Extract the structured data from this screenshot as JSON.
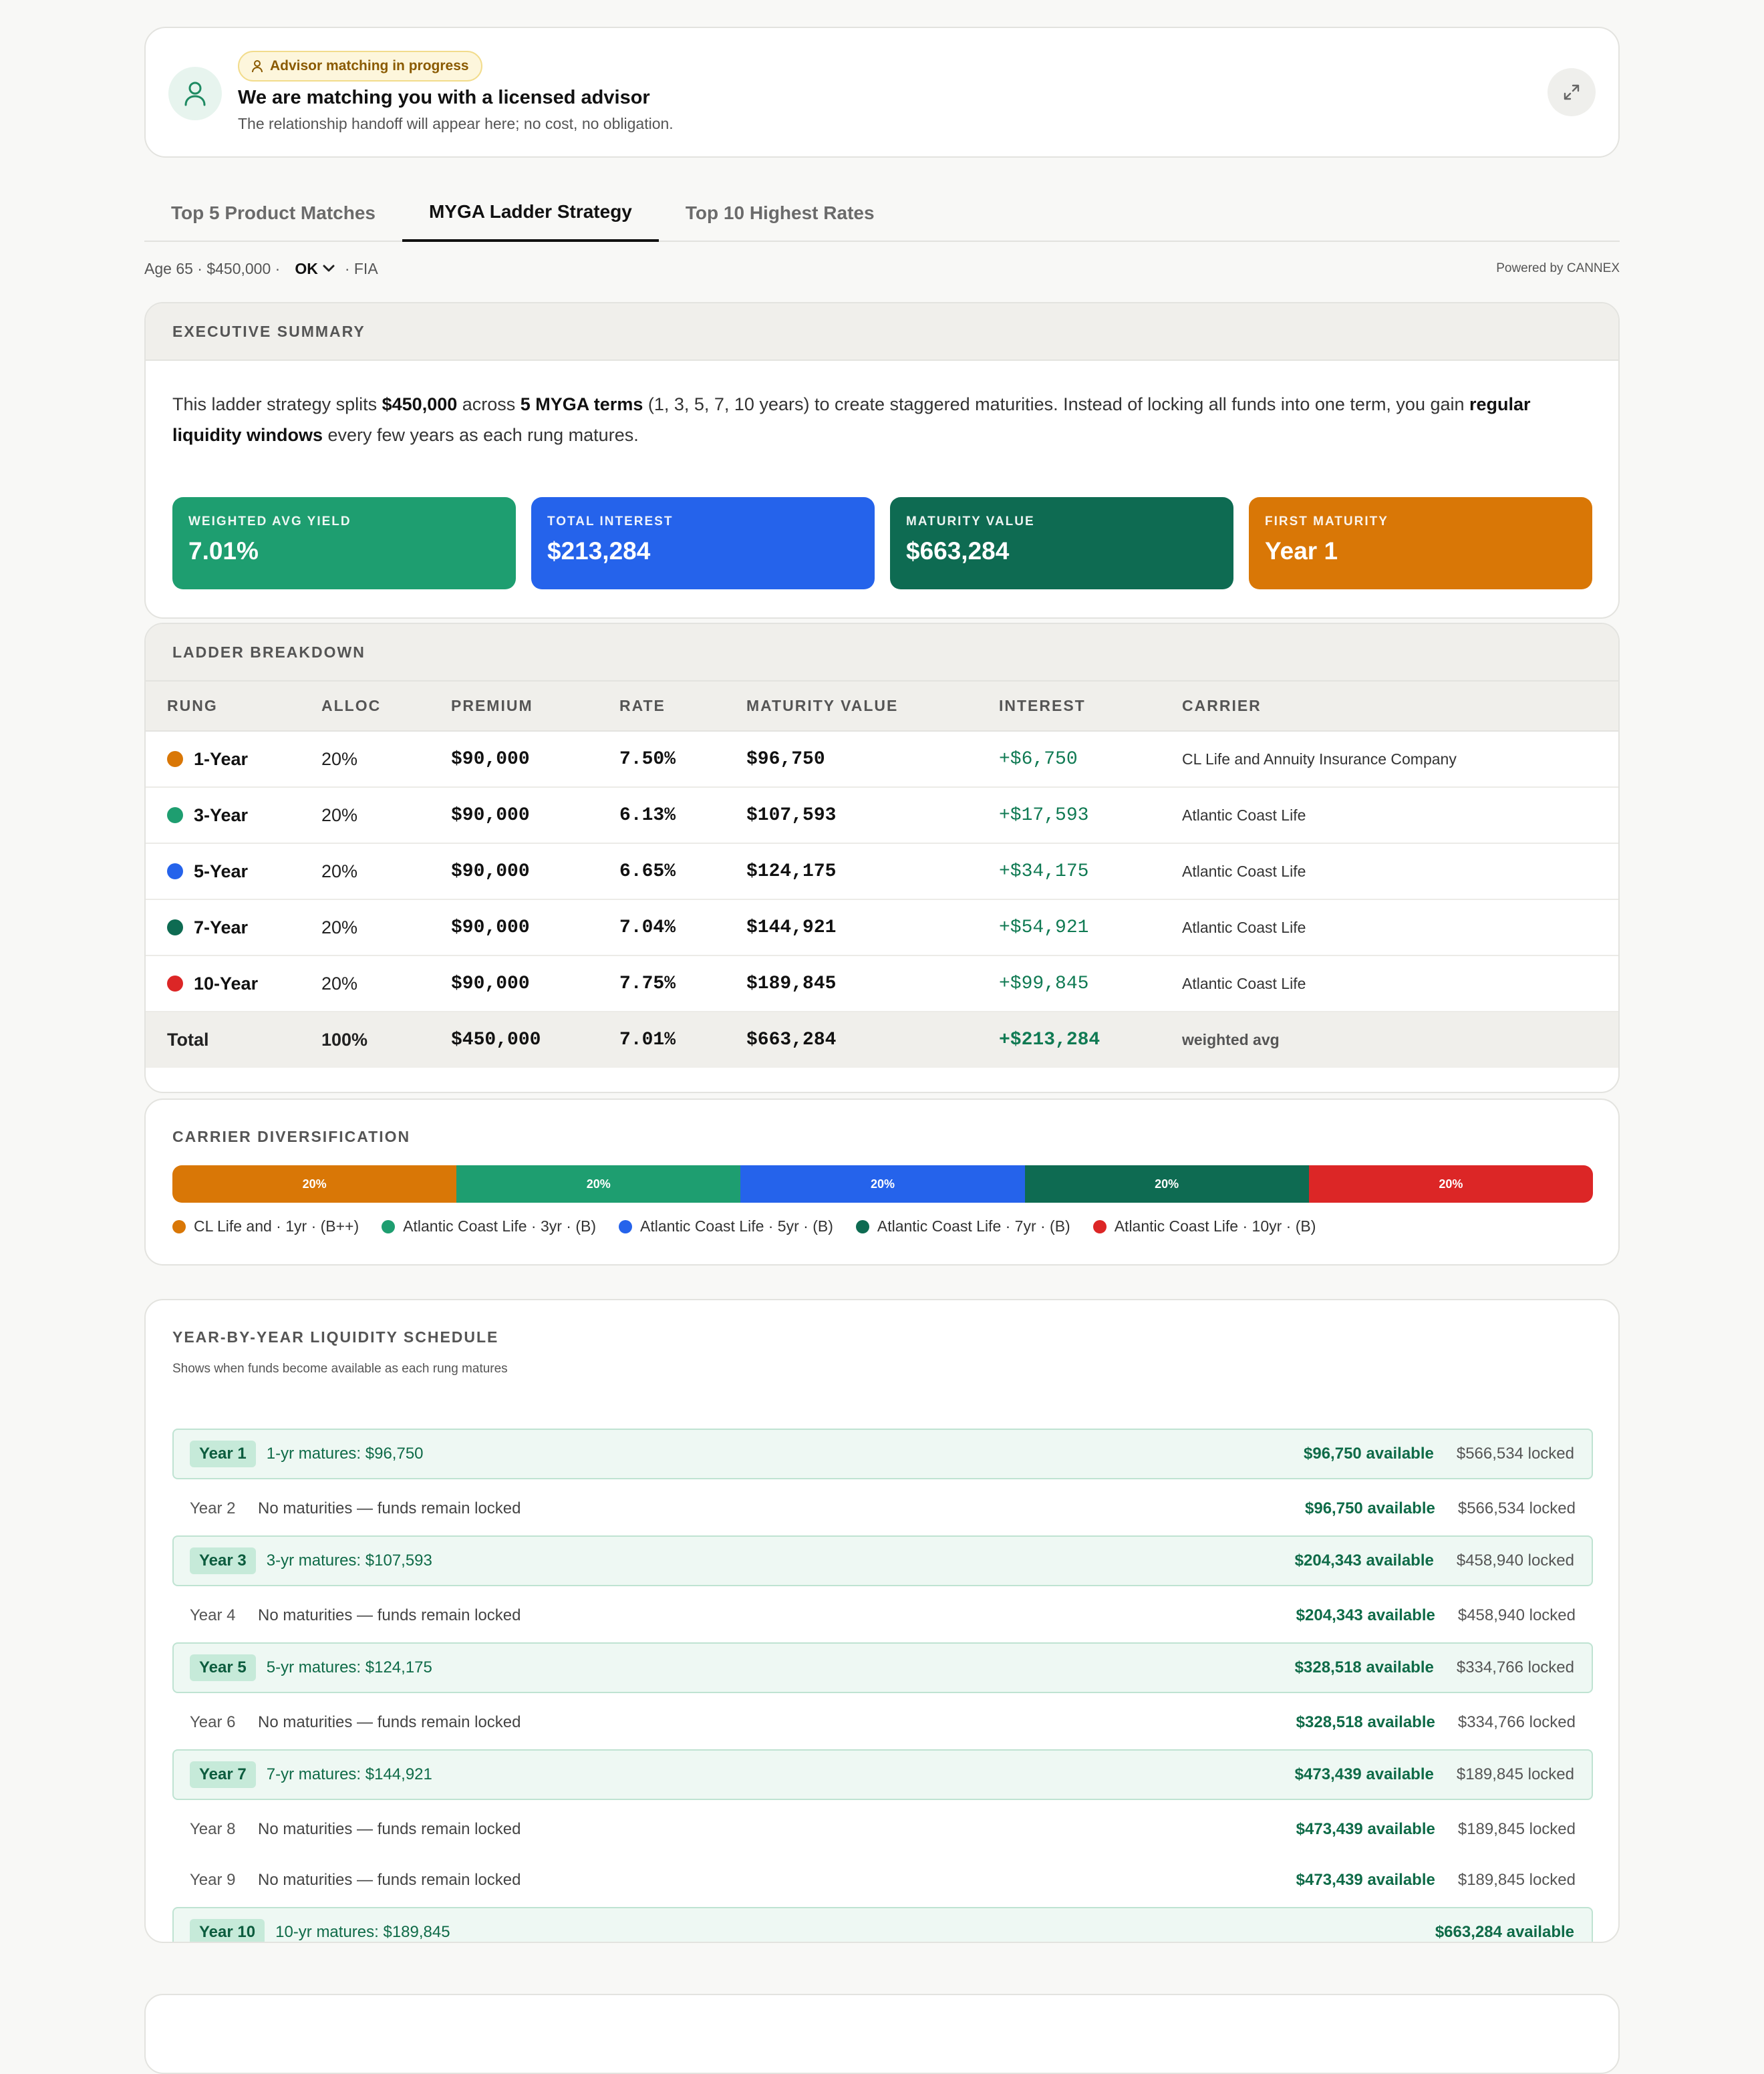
{
  "advisor": {
    "badge": "Advisor matching in progress",
    "title": "We are matching you with a licensed advisor",
    "subtitle": "The relationship handoff will appear here; no cost, no obligation."
  },
  "tabs": [
    "Top 5 Product Matches",
    "MYGA Ladder Strategy",
    "Top 10 Highest Rates"
  ],
  "active_tab": "MYGA Ladder Strategy",
  "filters": {
    "prefix": "Age 65 · $450,000 ·",
    "state": "OK",
    "suffix": "· FIA",
    "powered_by": "Powered by CANNEX"
  },
  "executive_summary": {
    "heading": "EXECUTIVE SUMMARY",
    "text_1": "This ladder strategy splits ",
    "bold_1": "$450,000",
    "text_2": " across ",
    "bold_2": "5 MYGA terms",
    "text_3": " (1, 3, 5, 7, 10 years) to create staggered maturities. Instead of locking all funds into one term, you gain ",
    "bold_3": "regular liquidity windows",
    "text_4": " every few years as each rung matures.",
    "tiles": [
      {
        "label": "WEIGHTED AVG YIELD",
        "value": "7.01%",
        "color": "#1e9e70"
      },
      {
        "label": "TOTAL INTEREST",
        "value": "$213,284",
        "color": "#2563eb"
      },
      {
        "label": "MATURITY VALUE",
        "value": "$663,284",
        "color": "#0e6b52"
      },
      {
        "label": "FIRST MATURITY",
        "value": "Year 1",
        "color": "#d97706"
      }
    ]
  },
  "ladder": {
    "heading": "LADDER BREAKDOWN",
    "columns": [
      "RUNG",
      "ALLOC",
      "PREMIUM",
      "RATE",
      "MATURITY VALUE",
      "INTEREST",
      "CARRIER"
    ],
    "rows": [
      {
        "rung": "1-Year",
        "color": "#d97706",
        "alloc": "20%",
        "premium": "$90,000",
        "rate": "7.50%",
        "maturity": "$96,750",
        "interest": "+$6,750",
        "carrier": "CL Life and Annuity Insurance Company"
      },
      {
        "rung": "3-Year",
        "color": "#1e9e70",
        "alloc": "20%",
        "premium": "$90,000",
        "rate": "6.13%",
        "maturity": "$107,593",
        "interest": "+$17,593",
        "carrier": "Atlantic Coast Life"
      },
      {
        "rung": "5-Year",
        "color": "#2563eb",
        "alloc": "20%",
        "premium": "$90,000",
        "rate": "6.65%",
        "maturity": "$124,175",
        "interest": "+$34,175",
        "carrier": "Atlantic Coast Life"
      },
      {
        "rung": "7-Year",
        "color": "#0e6b52",
        "alloc": "20%",
        "premium": "$90,000",
        "rate": "7.04%",
        "maturity": "$144,921",
        "interest": "+$54,921",
        "carrier": "Atlantic Coast Life"
      },
      {
        "rung": "10-Year",
        "color": "#dc2626",
        "alloc": "20%",
        "premium": "$90,000",
        "rate": "7.75%",
        "maturity": "$189,845",
        "interest": "+$99,845",
        "carrier": "Atlantic Coast Life"
      }
    ],
    "total": {
      "rung": "Total",
      "alloc": "100%",
      "premium": "$450,000",
      "rate": "7.01%",
      "maturity": "$663,284",
      "interest": "+$213,284",
      "carrier": "weighted avg"
    }
  },
  "diversification": {
    "heading": "CARRIER DIVERSIFICATION",
    "segments": [
      {
        "share": 20,
        "label": "20%",
        "color": "#d97706",
        "legend": "CL Life and · 1yr · (B++)"
      },
      {
        "share": 20,
        "label": "20%",
        "color": "#1e9e70",
        "legend": "Atlantic Coast Life · 3yr · (B)"
      },
      {
        "share": 20,
        "label": "20%",
        "color": "#2563eb",
        "legend": "Atlantic Coast Life · 5yr · (B)"
      },
      {
        "share": 20,
        "label": "20%",
        "color": "#0e6b52",
        "legend": "Atlantic Coast Life · 7yr · (B)"
      },
      {
        "share": 20,
        "label": "20%",
        "color": "#dc2626",
        "legend": "Atlantic Coast Life · 10yr · (B)"
      }
    ]
  },
  "liquidity": {
    "heading": "YEAR-BY-YEAR LIQUIDITY SCHEDULE",
    "subheading": "Shows when funds become available as each rung matures",
    "rows": [
      {
        "year": "Year 1",
        "matures": true,
        "desc": "1-yr matures: $96,750",
        "available": "$96,750 available",
        "locked": "$566,534 locked"
      },
      {
        "year": "Year 2",
        "matures": false,
        "desc": "No maturities — funds remain locked",
        "available": "$96,750 available",
        "locked": "$566,534 locked"
      },
      {
        "year": "Year 3",
        "matures": true,
        "desc": "3-yr matures: $107,593",
        "available": "$204,343 available",
        "locked": "$458,940 locked"
      },
      {
        "year": "Year 4",
        "matures": false,
        "desc": "No maturities — funds remain locked",
        "available": "$204,343 available",
        "locked": "$458,940 locked"
      },
      {
        "year": "Year 5",
        "matures": true,
        "desc": "5-yr matures: $124,175",
        "available": "$328,518 available",
        "locked": "$334,766 locked"
      },
      {
        "year": "Year 6",
        "matures": false,
        "desc": "No maturities — funds remain locked",
        "available": "$328,518 available",
        "locked": "$334,766 locked"
      },
      {
        "year": "Year 7",
        "matures": true,
        "desc": "7-yr matures: $144,921",
        "available": "$473,439 available",
        "locked": "$189,845 locked"
      },
      {
        "year": "Year 8",
        "matures": false,
        "desc": "No maturities — funds remain locked",
        "available": "$473,439 available",
        "locked": "$189,845 locked"
      },
      {
        "year": "Year 9",
        "matures": false,
        "desc": "No maturities — funds remain locked",
        "available": "$473,439 available",
        "locked": "$189,845 locked"
      },
      {
        "year": "Year 10",
        "matures": true,
        "desc": "10-yr matures: $189,845",
        "available": "$663,284 available",
        "locked": ""
      }
    ]
  }
}
